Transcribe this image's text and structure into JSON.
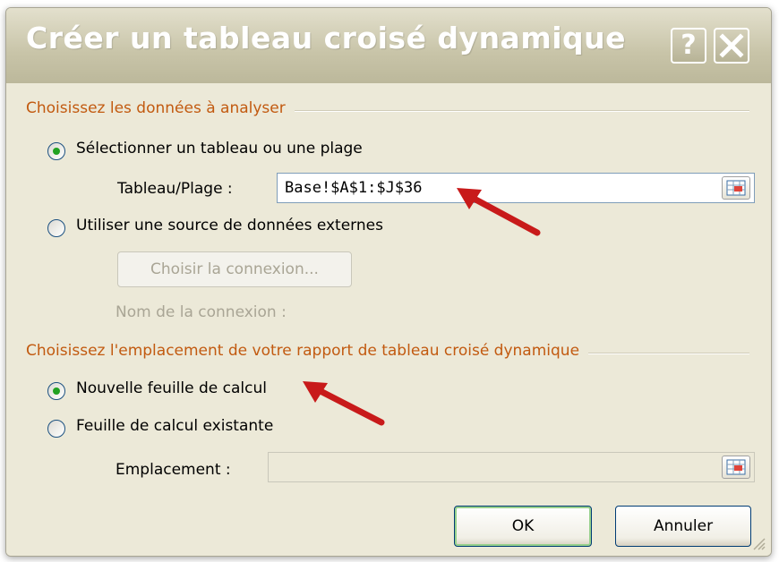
{
  "dialog": {
    "title": "Créer un tableau croisé dynamique",
    "help_glyph": "?",
    "help_icon": "help-icon",
    "close_icon": "close-icon"
  },
  "section_data": {
    "label": "Choisissez les données à analyser",
    "option_table": {
      "label": "Sélectionner un tableau ou une plage",
      "checked": true
    },
    "range_label": "Tableau/Plage :",
    "range_value": "Base!$A$1:$J$36",
    "option_external": {
      "label": "Utiliser une source de données externes",
      "checked": false
    },
    "choose_connection_label": "Choisir la connexion...",
    "connection_name_label": "Nom de la connexion :"
  },
  "section_location": {
    "label": "Choisissez l'emplacement de votre rapport de tableau croisé dynamique",
    "option_new_sheet": {
      "label": "Nouvelle feuille de calcul",
      "checked": true
    },
    "option_existing_sheet": {
      "label": "Feuille de calcul existante",
      "checked": false
    },
    "location_label": "Emplacement :",
    "location_value": ""
  },
  "buttons": {
    "ok": "OK",
    "cancel": "Annuler"
  },
  "colors": {
    "group_label": "#c25a10",
    "dialog_bg": "#ece9d8",
    "radio_checked": "#21a121",
    "annotation_arrow": "#c81a1a"
  }
}
